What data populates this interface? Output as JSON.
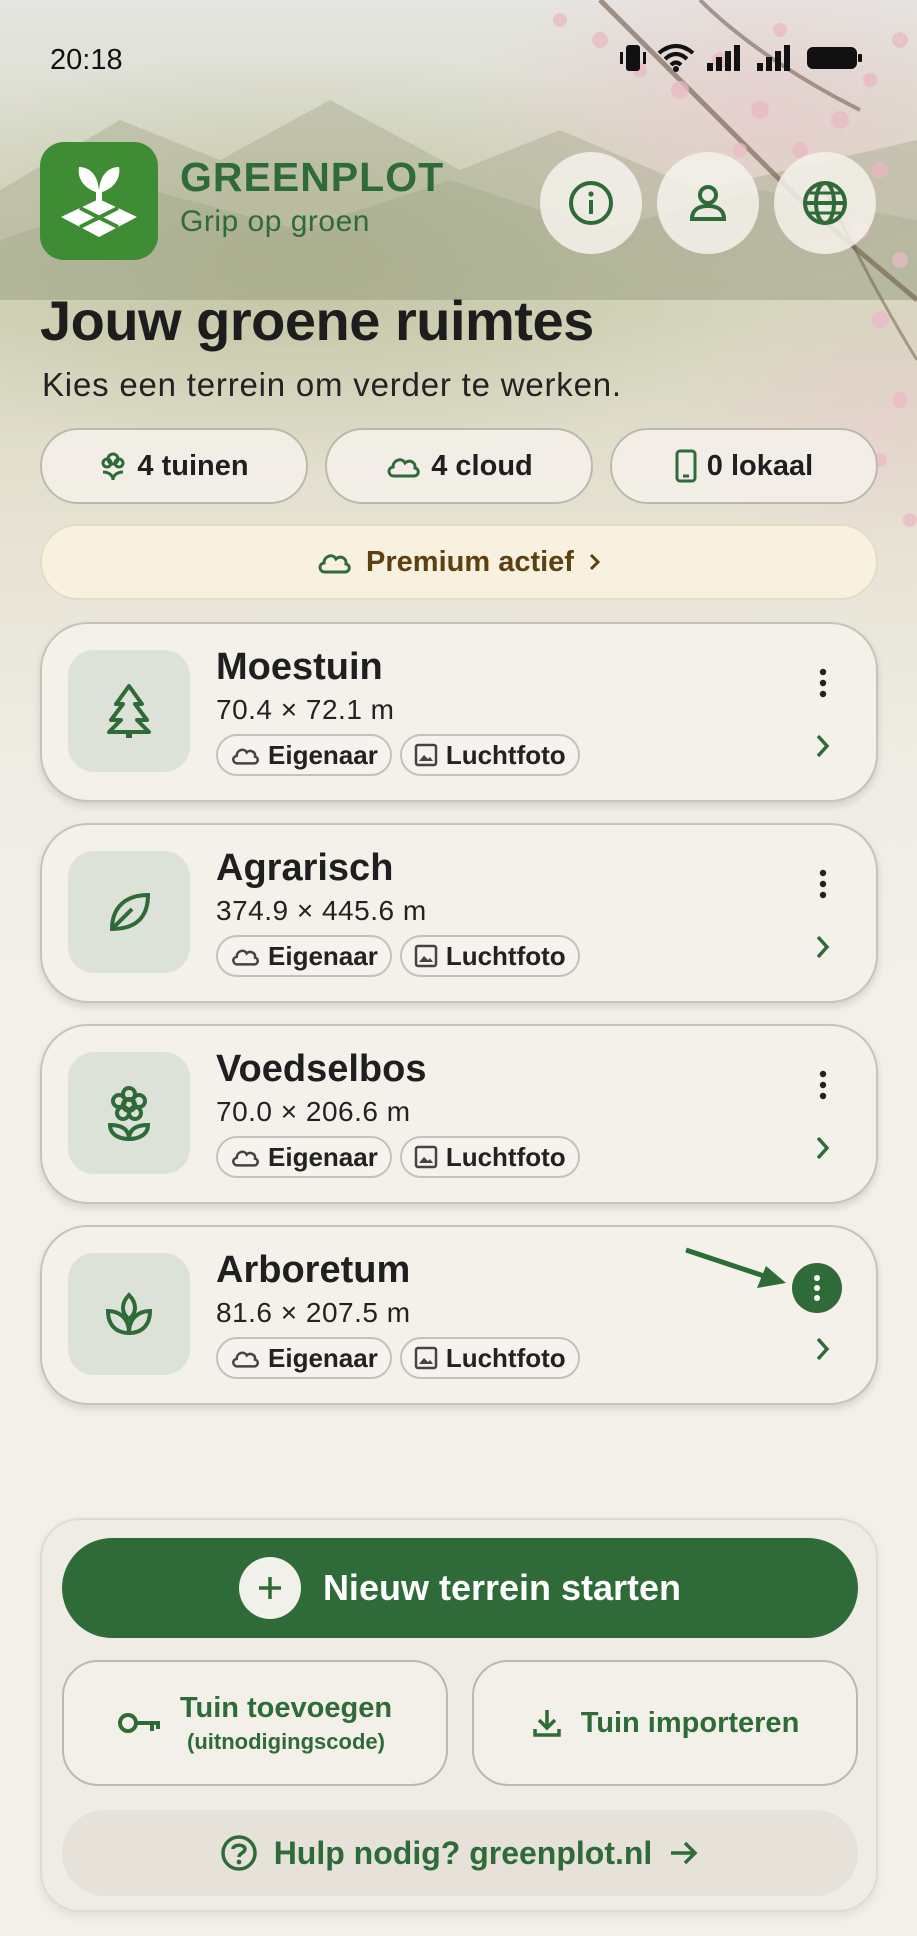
{
  "status_bar": {
    "time": "20:18"
  },
  "header": {
    "brand_name": "GREENPLOT",
    "tagline": "Grip op groen",
    "buttons": [
      {
        "icon": "info-icon"
      },
      {
        "icon": "account-icon"
      },
      {
        "icon": "globe-icon"
      }
    ]
  },
  "page": {
    "title": "Jouw groene ruimtes",
    "subtitle": "Kies een terrein om verder te werken."
  },
  "stats": {
    "gardens": "4 tuinen",
    "cloud": "4 cloud",
    "local": "0 lokaal"
  },
  "premium": {
    "label": "Premium actief"
  },
  "gardens": [
    {
      "name": "Moestuin",
      "dims": "70.4 × 72.1 m",
      "icon": "tree-icon",
      "role": "Eigenaar",
      "layer": "Luchtfoto"
    },
    {
      "name": "Agrarisch",
      "dims": "374.9 × 445.6 m",
      "icon": "leaf-icon",
      "role": "Eigenaar",
      "layer": "Luchtfoto"
    },
    {
      "name": "Voedselbos",
      "dims": "70.0 × 206.6 m",
      "icon": "flower-icon",
      "role": "Eigenaar",
      "layer": "Luchtfoto"
    },
    {
      "name": "Arboretum",
      "dims": "81.6 × 207.5 m",
      "icon": "sprout-icon",
      "role": "Eigenaar",
      "layer": "Luchtfoto"
    }
  ],
  "actions": {
    "new_terrain": "Nieuw terrein starten",
    "add_garden": "Tuin toevoegen",
    "add_garden_sub": "(uitnodigingscode)",
    "import_garden": "Tuin importeren",
    "help": "Hulp nodig? greenplot.nl"
  },
  "colors": {
    "brand_green": "#2f6b38",
    "logo_green": "#3e8c34",
    "premium_bg": "#f8f1df",
    "premium_text": "#5b4012",
    "background": "#f3f0ea"
  }
}
